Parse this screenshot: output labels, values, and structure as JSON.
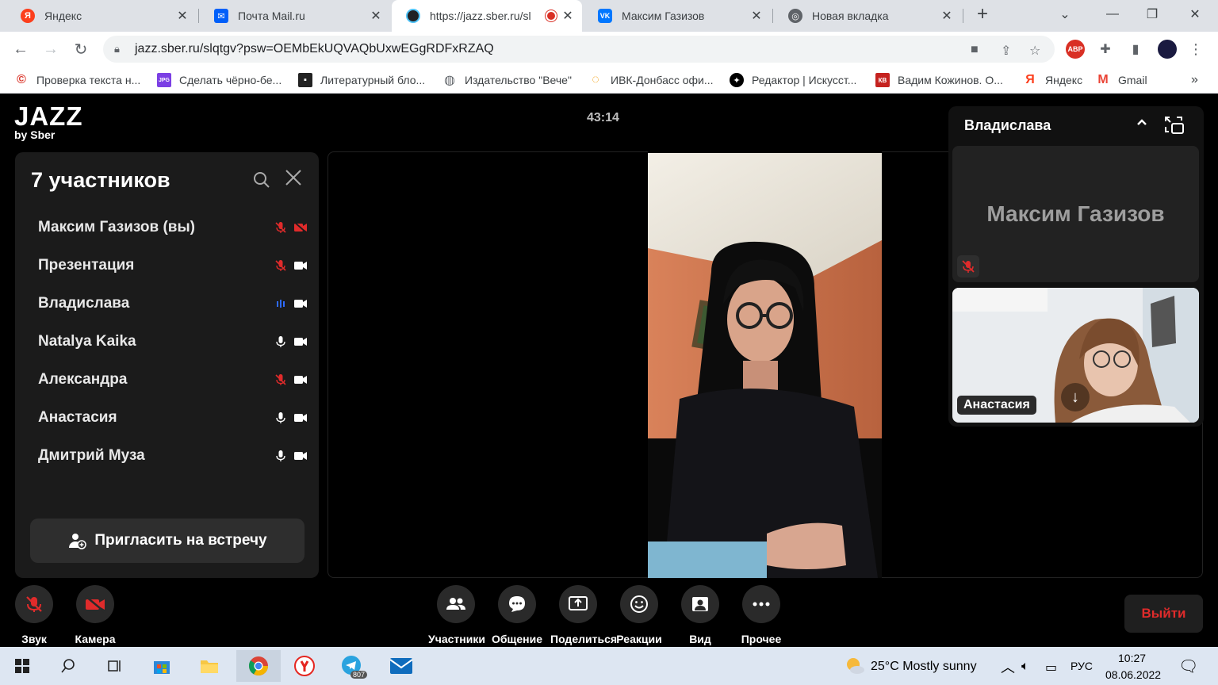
{
  "browser": {
    "tabs": [
      {
        "title": "Яндекс",
        "icon": "yandex-icon",
        "color": "#fc3f1d",
        "glyph": "Я"
      },
      {
        "title": "Почта Mail.ru",
        "icon": "mail-ru-icon",
        "color": "#005ff9",
        "glyph": "@"
      },
      {
        "title": "https://jazz.sber.ru/sl",
        "icon": "jazz-icon",
        "color": "#202124",
        "glyph": "◉"
      },
      {
        "title": "Максим Газизов",
        "icon": "vk-icon",
        "color": "#0077ff",
        "glyph": "VK"
      },
      {
        "title": "Новая вкладка",
        "icon": "chrome-icon",
        "color": "#5f6368",
        "glyph": "◎"
      }
    ],
    "new_tab": "+",
    "url": "jazz.sber.ru/slqtgv?psw=OEMbEkUQVAQbUxwEGgRDFxRZAQ",
    "bookmarks": [
      {
        "label": "Проверка текста н...",
        "icon": "copyright-icon",
        "glyph": "©",
        "color": "#d93025"
      },
      {
        "label": "Сделать чёрно-бе...",
        "icon": "jpg-icon",
        "glyph": "JPG",
        "color": "#7b3fe4"
      },
      {
        "label": "Литературный бло...",
        "icon": "blog-icon",
        "glyph": "▪",
        "color": "#222"
      },
      {
        "label": "Издательство \"Вече\"",
        "icon": "globe-icon",
        "glyph": "◍",
        "color": "#5f6368"
      },
      {
        "label": "ИВК-Донбасс офи...",
        "icon": "ivk-icon",
        "glyph": "◌",
        "color": "#f29900"
      },
      {
        "label": "Редактор | Искусст...",
        "icon": "editor-icon",
        "glyph": "✦",
        "color": "#000"
      },
      {
        "label": "Вадим Кожинов. О...",
        "icon": "kb-icon",
        "glyph": "КВ",
        "color": "#c5221f"
      },
      {
        "label": "Яндекс",
        "icon": "yandex-icon",
        "glyph": "Я",
        "color": "#fc3f1d"
      },
      {
        "label": "Gmail",
        "icon": "gmail-icon",
        "glyph": "M",
        "color": "#ea4335"
      }
    ],
    "more_bookmarks": "»"
  },
  "app": {
    "logo_main": "JAZZ",
    "logo_sub": "by Sber",
    "timer": "43:14",
    "participants_panel": {
      "title": "7 участников",
      "participants": [
        {
          "name": "Максим Газизов (вы)",
          "mic": "muted",
          "cam": "off"
        },
        {
          "name": "Презентация",
          "mic": "muted",
          "cam": "on"
        },
        {
          "name": "Владислава",
          "mic": "speaking",
          "cam": "on"
        },
        {
          "name": "Natalya Kaika",
          "mic": "on",
          "cam": "on"
        },
        {
          "name": "Александра",
          "mic": "muted",
          "cam": "on"
        },
        {
          "name": "Анастасия",
          "mic": "on",
          "cam": "on"
        },
        {
          "name": "Дмитрий Муза",
          "mic": "on",
          "cam": "on"
        }
      ],
      "invite_label": "Пригласить на встречу"
    },
    "side_panel": {
      "title": "Владислава",
      "tile1_name": "Максим Газизов",
      "tile2_name": "Анастасия"
    },
    "controls": {
      "sound": "Звук",
      "camera": "Камера",
      "participants": "Участники",
      "chat": "Общение",
      "share": "Поделиться",
      "reactions": "Реакции",
      "view": "Вид",
      "more": "Прочее",
      "leave": "Выйти"
    },
    "colors": {
      "muted": "#e02b2b",
      "speaking": "#2e6bff",
      "panel": "#1b1b1b"
    }
  },
  "taskbar": {
    "weather": "25°C  Mostly sunny",
    "lang": "РУС",
    "time": "10:27",
    "date": "08.06.2022",
    "telegram_badge": "807"
  }
}
